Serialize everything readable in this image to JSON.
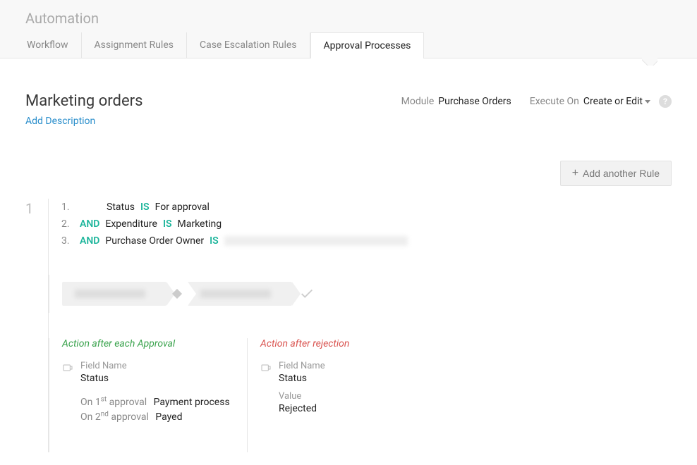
{
  "header": {
    "title": "Automation",
    "tabs": [
      "Workflow",
      "Assignment Rules",
      "Case Escalation Rules",
      "Approval Processes"
    ],
    "active_tab": 3
  },
  "rule": {
    "title": "Marketing orders",
    "add_description": "Add Description",
    "meta": {
      "module_label": "Module",
      "module_value": "Purchase Orders",
      "execute_label": "Execute On",
      "execute_value": "Create or Edit"
    }
  },
  "add_rule_btn": "Add another Rule",
  "rule_number": "1",
  "conditions": [
    {
      "n": "1.",
      "connector": "",
      "field": "Status",
      "op": "IS",
      "value": "For approval"
    },
    {
      "n": "2.",
      "connector": "AND",
      "field": "Expenditure",
      "op": "IS",
      "value": "Marketing"
    },
    {
      "n": "3.",
      "connector": "AND",
      "field": "Purchase Order Owner",
      "op": "IS",
      "value_redacted": true
    }
  ],
  "actions": {
    "approval": {
      "title": "Action after each Approval",
      "field_label": "Field Name",
      "field_value": "Status",
      "steps": [
        {
          "label_pre": "On 1",
          "label_sup": "st",
          "label_post": " approval",
          "value": "Payment process"
        },
        {
          "label_pre": "On 2",
          "label_sup": "nd",
          "label_post": " approval",
          "value": "Payed"
        }
      ]
    },
    "rejection": {
      "title": "Action after rejection",
      "field_label": "Field Name",
      "field_value": "Status",
      "value_label": "Value",
      "value": "Rejected"
    }
  }
}
